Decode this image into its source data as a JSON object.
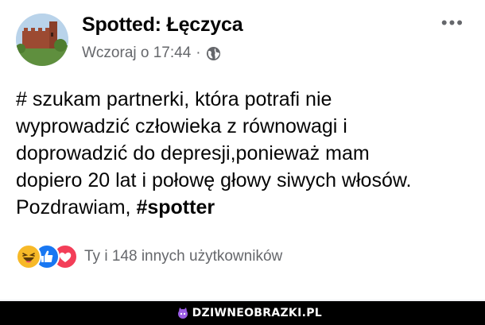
{
  "post": {
    "author": "Spotted: Łęczyca",
    "timestamp": "Wczoraj o 17:44",
    "separator": "·",
    "audience_icon": "globe-icon",
    "more_label": "•••",
    "text_lines": [
      "# szukam partnerki, która potrafi nie",
      "wyprowadzić człowieka z równowagi i",
      "doprowadzić do depresji,ponieważ mam",
      "dopiero 20 lat i połowę głowy siwych włosów.",
      "Pozdrawiam, "
    ],
    "hashtag": "#spotter",
    "reactions": {
      "icons": [
        "haha-icon",
        "like-icon",
        "love-icon"
      ],
      "summary": "Ty i 148 innych użytkowników"
    }
  },
  "watermark": {
    "text": "DZIWNEOBRAZKI.PL",
    "icon": "cat-logo-icon"
  },
  "colors": {
    "text": "#050505",
    "secondary_text": "#65676b",
    "like_blue": "#1877f2",
    "love_red": "#f33e58",
    "haha_yellow": "#f7b928",
    "footer_bg": "#000000"
  }
}
